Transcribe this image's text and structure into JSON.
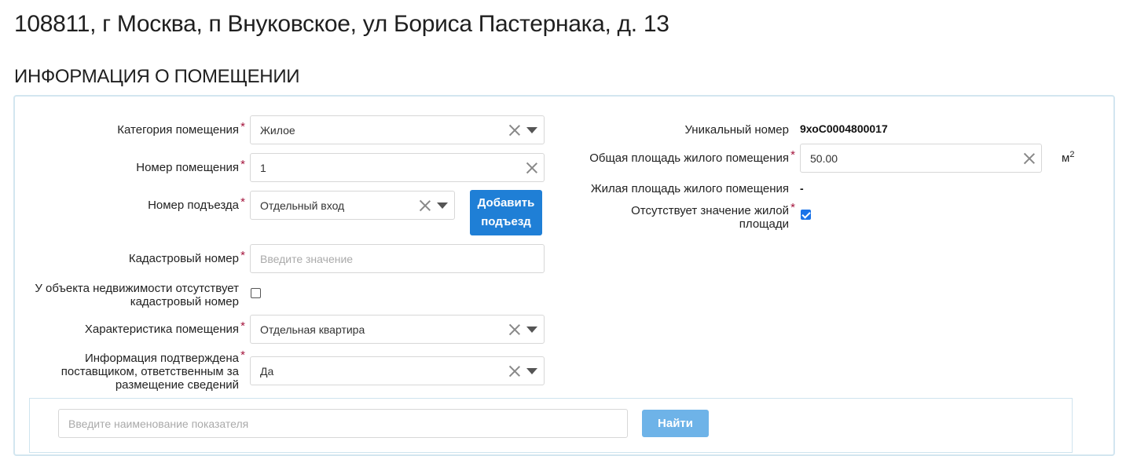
{
  "page": {
    "address_title": "108811, г Москва, п Внуковское, ул Бориса Пастернака, д. 13",
    "section_title": "ИНФОРМАЦИЯ О ПОМЕЩЕНИИ"
  },
  "form_left": {
    "category": {
      "label": "Категория помещения",
      "value": "Жилое"
    },
    "room_number": {
      "label": "Номер помещения",
      "value": "1"
    },
    "entrance": {
      "label": "Номер подъезда",
      "value": "Отдельный вход",
      "add_button": "Добавить подъезд"
    },
    "cadastral": {
      "label": "Кадастровый номер",
      "placeholder": "Введите значение"
    },
    "no_cadastral": {
      "label": "У объекта недвижимости отсутствует кадастровый номер",
      "checked": false
    },
    "characteristic": {
      "label": "Характеристика помещения",
      "value": "Отдельная квартира"
    },
    "confirmed": {
      "label": "Информация подтверждена поставщиком, ответственным за размещение сведений",
      "value": "Да"
    }
  },
  "form_right": {
    "unique_number": {
      "label": "Уникальный номер",
      "value": "9хоС0004800017"
    },
    "total_area": {
      "label": "Общая площадь жилого помещения",
      "value": "50.00",
      "unit": "м",
      "unit_power": "2"
    },
    "living_area": {
      "label": "Жилая площадь жилого помещения",
      "value": "-"
    },
    "no_living_area": {
      "label": "Отсутствует значение жилой площади",
      "checked": true
    }
  },
  "required_mark": "*",
  "search": {
    "placeholder": "Введите наименование показателя",
    "button": "Найти"
  },
  "colors": {
    "primary_button": "#1f7fd6",
    "secondary_button": "#6eb3e8",
    "required": "#a4143c",
    "panel_border": "#d3e6f0"
  }
}
